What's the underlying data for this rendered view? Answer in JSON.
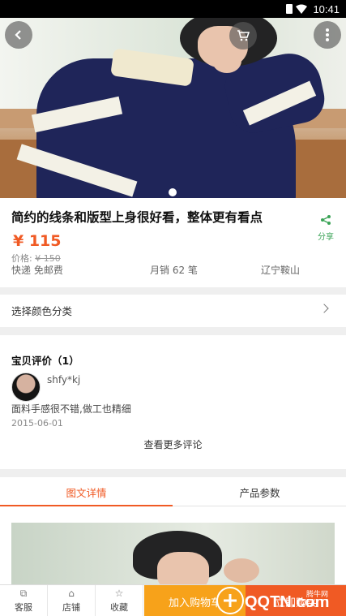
{
  "status_bar": {
    "time": "10:41"
  },
  "product": {
    "title": "简约的线条和版型上身很好看，整体更有看点",
    "price": "¥ 115",
    "original_price_label": "价格:",
    "original_price": "¥ 150",
    "shipping": "快递 免邮费",
    "sales": "月销 62 笔",
    "location": "辽宁鞍山",
    "share_label": "分享"
  },
  "options": {
    "color_select_label": "选择颜色分类"
  },
  "reviews": {
    "heading": "宝贝评价（1）",
    "items": [
      {
        "user": "shfy*kj",
        "comment": "面料手感很不错,做工也精细",
        "date": "2015-06-01"
      }
    ],
    "more_label": "查看更多评论"
  },
  "tabs": [
    {
      "label": "图文详情",
      "active": true
    },
    {
      "label": "产品参数",
      "active": false
    }
  ],
  "bottom_bar": {
    "service_label": "客服",
    "store_label": "店铺",
    "favorite_label": "收藏",
    "add_to_cart_label": "加入购物车",
    "buy_now_label": "立即购买"
  },
  "colors": {
    "accent": "#f05a24",
    "cart": "#f7a21a",
    "share": "#3aa356"
  }
}
